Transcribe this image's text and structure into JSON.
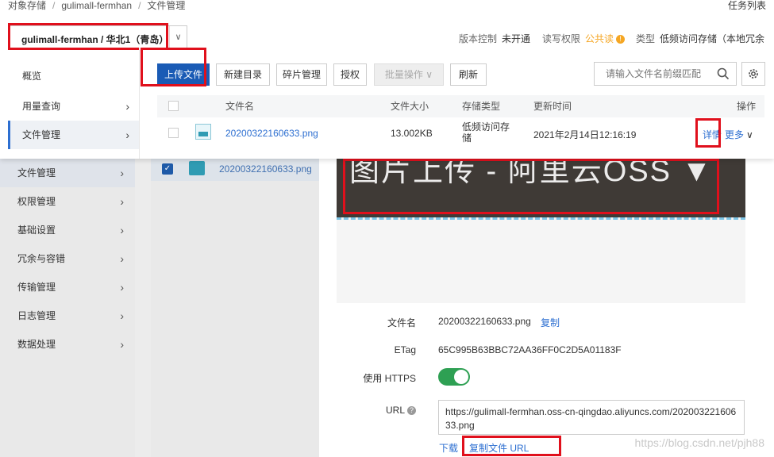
{
  "breadcrumb": [
    "对象存储",
    "gulimall-fermhan",
    "文件管理"
  ],
  "task_list": "任务列表",
  "bucket": {
    "name": "gulimall-fermhan / 华北1（青岛）"
  },
  "meta": {
    "version_control": {
      "label": "版本控制",
      "value": "未开通"
    },
    "acl": {
      "label": "读写权限",
      "value": "公共读"
    },
    "type": {
      "label": "类型",
      "value": "低频访问存储（本地冗余"
    }
  },
  "side_menu": [
    "概览",
    "用量查询",
    "文件管理"
  ],
  "toolbar": {
    "upload": "上传文件",
    "new_dir": "新建目录",
    "fragments": "碎片管理",
    "authorize": "授权",
    "batch": "批量操作",
    "refresh": "刷新",
    "search_placeholder": "请输入文件名前缀匹配"
  },
  "table": {
    "headers": {
      "name": "文件名",
      "size": "文件大小",
      "storage": "存储类型",
      "updated": "更新时间",
      "actions": "操作"
    },
    "row": {
      "name": "20200322160633.png",
      "size": "13.002KB",
      "storage": "低频访问存储",
      "updated": "2021年2月14日12:16:19",
      "detail": "详情",
      "more": "更多"
    }
  },
  "bg_nav": [
    "文件管理",
    "权限管理",
    "基础设置",
    "冗余与容错",
    "传输管理",
    "日志管理",
    "数据处理"
  ],
  "bg_list_file": "20200322160633.png",
  "preview_banner_text": "图片上传 - 阿里云OSS ▼",
  "detail": {
    "filename_label": "文件名",
    "filename": "20200322160633.png",
    "copy": "复制",
    "etag_label": "ETag",
    "etag": "65C995B63BBC72AA36FF0C2D5A01183F",
    "https_label": "使用 HTTPS",
    "https_on": true,
    "url_label": "URL",
    "url": "https://gulimall-fermhan.oss-cn-qingdao.aliyuncs.com/20200322160633.png",
    "download": "下载",
    "copy_url": "复制文件 URL"
  },
  "watermark": "https://blog.csdn.net/pjh88",
  "colors": {
    "primary": "#1a5bb5",
    "link": "#2d6fd1",
    "highlight": "#e0101c",
    "toggle_on": "#2ea053"
  }
}
